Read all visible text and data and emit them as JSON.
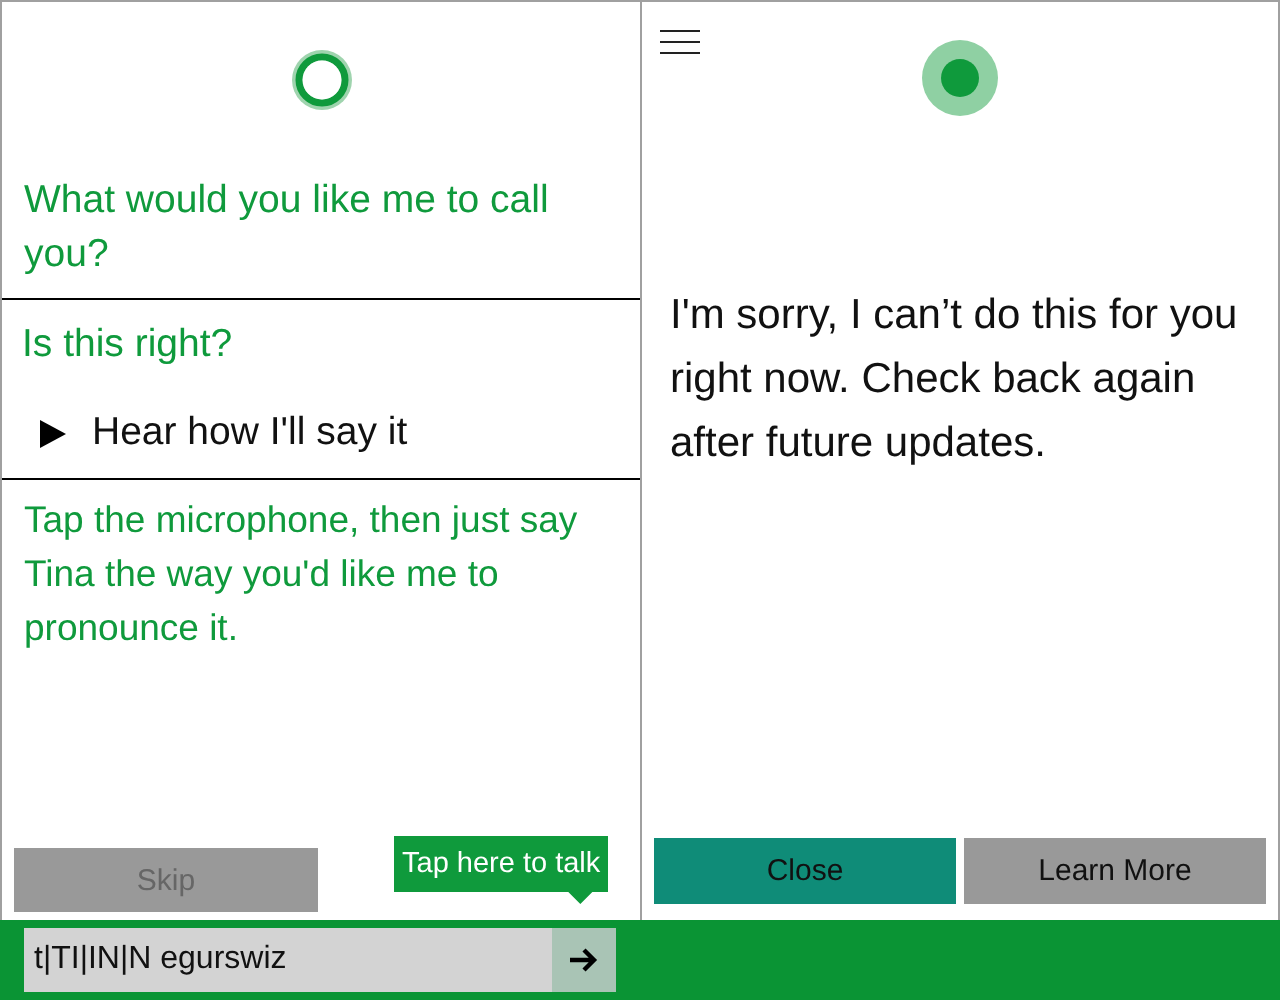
{
  "left_panel": {
    "question": "What would you like me to call you?",
    "confirm_heading": "Is this right?",
    "play_label": "Hear how I'll say it",
    "instruction": "Tap the microphone, then just say Tina the way you'd like me to pronounce it.",
    "skip_button": {
      "label": "Skip",
      "disabled": true
    },
    "tooltip": "Tap here to talk"
  },
  "right_panel": {
    "message": "I'm sorry, I can’t do this for you right now. Check back again after future updates.",
    "buttons": [
      {
        "label": "Close",
        "kind": "primary"
      },
      {
        "label": "Learn More",
        "kind": "secondary"
      }
    ]
  },
  "input_bar": {
    "value": "t|TI|IN|N egurswiz"
  }
}
